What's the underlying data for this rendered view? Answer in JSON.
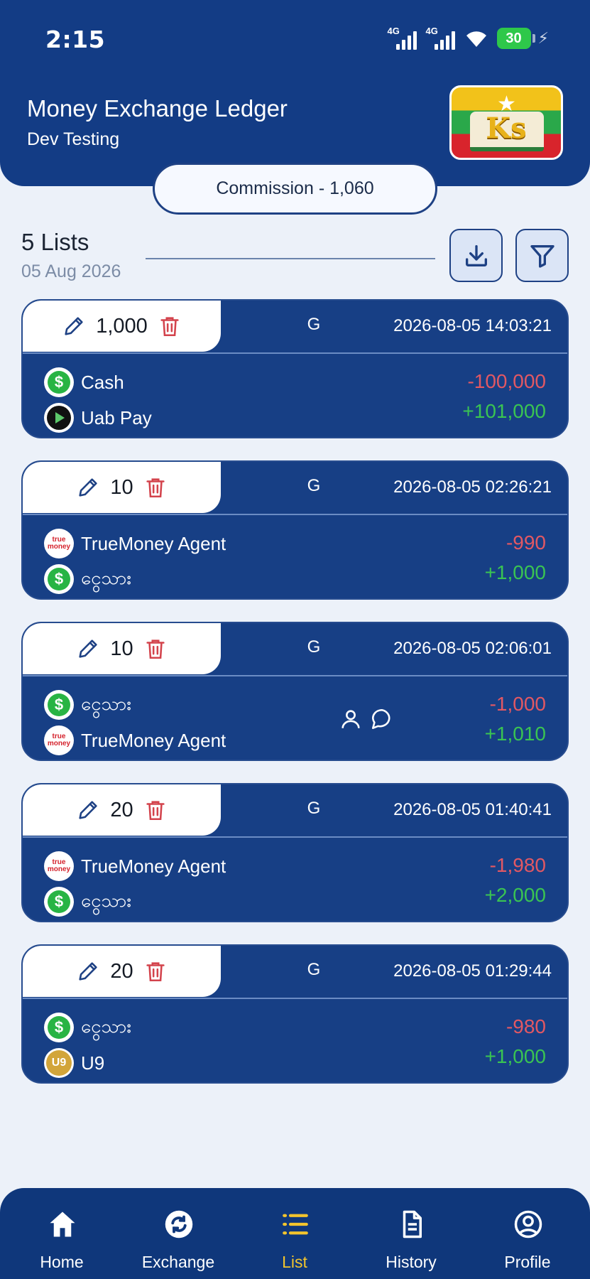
{
  "status_bar": {
    "time": "2:15",
    "net1": "4G",
    "net2": "4G",
    "battery": "30"
  },
  "header": {
    "title": "Money Exchange Ledger",
    "subtitle": "Dev Testing",
    "logo_text": "Ks"
  },
  "commission": "Commission - 1,060",
  "summary": {
    "count_label": "5 Lists",
    "date": "05 Aug 2026"
  },
  "colors": {
    "primary": "#133c85",
    "negative": "#e25863",
    "positive": "#3ac452",
    "active_nav": "#f2c42d"
  },
  "entries": [
    {
      "amount": "1,000",
      "type": "G",
      "datetime": "2026-08-05 14:03:21",
      "from_account": "Cash",
      "from_icon": "cash-icon",
      "to_account": "Uab Pay",
      "to_icon": "uab-pay-icon",
      "debit": "-100,000",
      "credit": "+101,000"
    },
    {
      "amount": "10",
      "type": "G",
      "datetime": "2026-08-05 02:26:21",
      "from_account": "TrueMoney Agent",
      "from_icon": "truemoney-icon",
      "to_account": "ငွေသား",
      "to_icon": "cash-icon",
      "debit": "-990",
      "credit": "+1,000"
    },
    {
      "amount": "10",
      "type": "G",
      "datetime": "2026-08-05 02:06:01",
      "from_account": "ငွေသား",
      "from_icon": "cash-icon",
      "to_account": "TrueMoney Agent",
      "to_icon": "truemoney-icon",
      "debit": "-1,000",
      "credit": "+1,010"
    },
    {
      "amount": "20",
      "type": "G",
      "datetime": "2026-08-05 01:40:41",
      "from_account": "TrueMoney Agent",
      "from_icon": "truemoney-icon",
      "to_account": "ငွေသား",
      "to_icon": "cash-icon",
      "debit": "-1,980",
      "credit": "+2,000"
    },
    {
      "amount": "20",
      "type": "G",
      "datetime": "2026-08-05 01:29:44",
      "from_account": "ငွေသား",
      "from_icon": "cash-icon",
      "to_account": "U9",
      "to_icon": "u9-icon",
      "debit": "-980",
      "credit": "+1,000"
    }
  ],
  "icon_text": {
    "dollar": "$",
    "truemoney": "true money",
    "u9": "U9"
  },
  "nav": [
    {
      "label": "Home",
      "icon": "home-icon"
    },
    {
      "label": "Exchange",
      "icon": "exchange-icon"
    },
    {
      "label": "List",
      "icon": "list-icon",
      "active": true
    },
    {
      "label": "History",
      "icon": "history-icon"
    },
    {
      "label": "Profile",
      "icon": "profile-icon"
    }
  ]
}
